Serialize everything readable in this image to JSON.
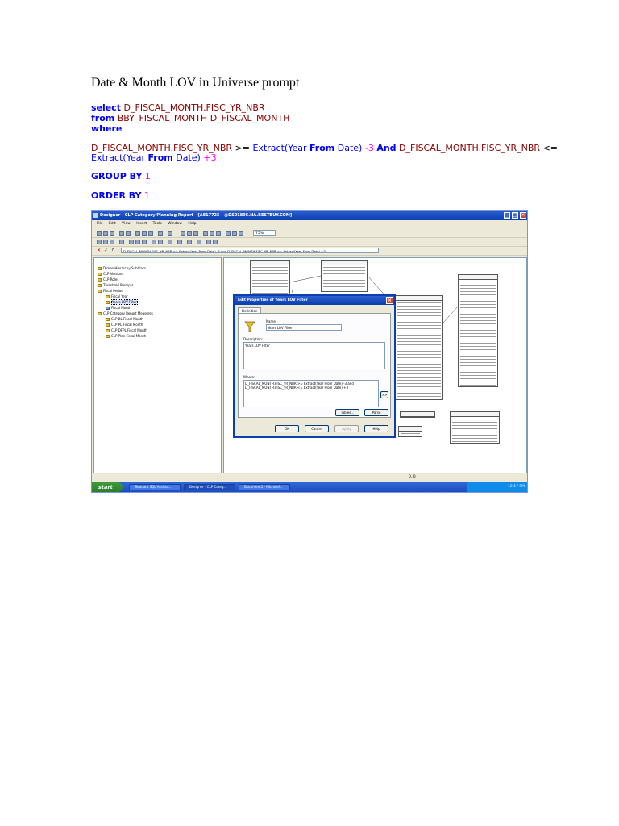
{
  "document": {
    "title": "Date & Month LOV in Universe prompt",
    "sql": {
      "select_kw": "select",
      "select_col": "D_FISCAL_MONTH.FISC_YR_NBR",
      "from_kw": "from",
      "from_tbl": "BBY_FISCAL_MONTH D_FISCAL_MONTH",
      "where_kw": "where",
      "cond_col1": "D_FISCAL_MONTH.FISC_YR_NBR",
      "cond_op1": ">=",
      "cond_fn1": "Extract(",
      "cond_year1": "Year",
      "cond_from1": "From",
      "cond_date1": "Date)",
      "cond_num1": "-3",
      "cond_and": "And",
      "cond_col2": "D_FISCAL_MONTH.FISC_YR_NBR",
      "cond_op2": "<=",
      "cond_fn2": "Extract(",
      "cond_year2": "Year",
      "cond_from2": "From",
      "cond_date2": "Date)",
      "cond_num2": "+3",
      "group_kw": "GROUP BY",
      "group_num": "1",
      "order_kw": "ORDER BY",
      "order_num": "1"
    }
  },
  "screenshot": {
    "window_title": "Designer - CLP Category Planning Report - [A817725 - @DS01895.NA.BESTBUY.COM]",
    "menu": [
      "File",
      "Edit",
      "View",
      "Insert",
      "Tools",
      "Window",
      "Help"
    ],
    "zoom": "75%",
    "formula": "D_FISCAL_MONTH.FISC_YR_NBR >= Extract(Year From Date) -3 and D_FISCAL_MONTH.FISC_YR_NBR <= Extract(Year From Date) +3",
    "tree": [
      "Dimen Hierarchy SubClass",
      "CLP Versions",
      "CLP Roles",
      "Threshold Prompts",
      "Fiscal Period",
      "Fiscal Year",
      "Years LOV Filter",
      "Fiscal Month",
      "CLP Category Report Measures",
      "CLP BL Fiscal Month",
      "CLP PL Fiscal Month",
      "CLP DFPL Fiscal Month",
      "CLP Plan Fiscal Month"
    ],
    "dialog": {
      "title": "Edit Properties of Years LOV Filter",
      "tab": "Definition",
      "name_label": "Name:",
      "name_value": "Years LOV Filter",
      "desc_label": "Description:",
      "desc_value": "Years LOV Filter",
      "where_label": "Where:",
      "where_value": "D_FISCAL_MONTH.FISC_YR_NBR >= Extract(Year From Date) -3 and\nD_FISCAL_MONTH.FISC_YR_NBR <= Extract(Year From Date) +3",
      "expand_btn": ">>",
      "tables_btn": "Tables...",
      "parse_btn": "Parse",
      "ok_btn": "OK",
      "cancel_btn": "Cancel",
      "apply_btn": "Apply",
      "help_btn": "Help"
    },
    "status_coords": "0, 0",
    "taskbar": {
      "start": "start",
      "tasks": [
        "Teradata SQL Assista...",
        "Designer - CLP Categ...",
        "Document1 - Microsof..."
      ],
      "clock": "12:17 PM"
    }
  }
}
